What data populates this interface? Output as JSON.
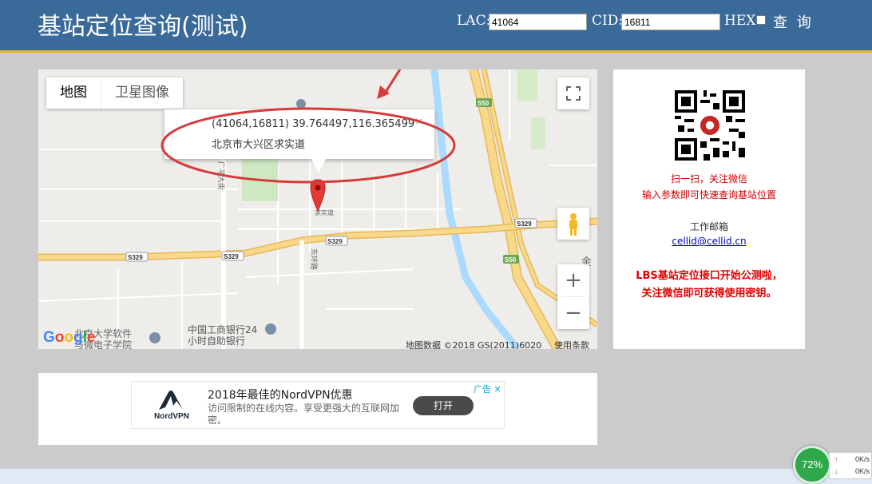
{
  "header": {
    "title": "基站定位查询(测试)",
    "lac_label": "LAC:",
    "lac_value": "41064",
    "cid_label": "CID:",
    "cid_value": "16811",
    "hex_label": "HEX:",
    "hex_checked": false,
    "query_label": "查 询"
  },
  "map": {
    "tab_map": "地图",
    "tab_satellite": "卫星图像",
    "info_line1": "(41064,16811) 39.764497,116.365499",
    "info_line2": "北京市大兴区求实道",
    "info_close": "×",
    "attribution": "地图数据 ©2018 GS(2011)6020",
    "terms": "使用条款",
    "google_logo": "Google",
    "zoom_in": "+",
    "zoom_out": "−",
    "labels": {
      "s50_a": "S50",
      "s50_b": "S50",
      "s329_a": "S329",
      "s329_b": "S329",
      "s329_c": "S329",
      "s329_d": "S329",
      "bank": "中国工商银行24\n小时自助银行",
      "bank_1": "中国工商银行24",
      "bank_2": "小时自助银行",
      "univ_1": "北京大学软件",
      "univ_2": "与微电子学院",
      "jin": "金",
      "guangping": "广平大街",
      "dongxing": "东环路",
      "qiushi": "求实道"
    }
  },
  "side": {
    "scan_line1": "扫一扫，关注微信",
    "scan_line2": "输入参数即可快速查询基站位置",
    "email_label": "工作邮箱",
    "email": "cellid@cellid.cn",
    "notice_line1": "LBS基站定位接口开始公测啦，",
    "notice_line2": "关注微信即可获得使用密钥。"
  },
  "ad": {
    "title": "2018年最佳的NordVPN优惠",
    "desc": "访问限制的在线内容。享受更强大的互联网加密。",
    "open": "打开",
    "tag": "广告 ✕",
    "brand": "NordVPN"
  },
  "net": {
    "percent": "72%",
    "up_arrow": "↑",
    "down_arrow": "↓",
    "up_speed": "0K/s",
    "down_speed": "0K/s"
  },
  "colors": {
    "header": "#3a6a9a",
    "header_border": "#e8b61e",
    "marker": "#e53935",
    "annotation": "#d63a3a",
    "highway": "#f6d27a"
  }
}
